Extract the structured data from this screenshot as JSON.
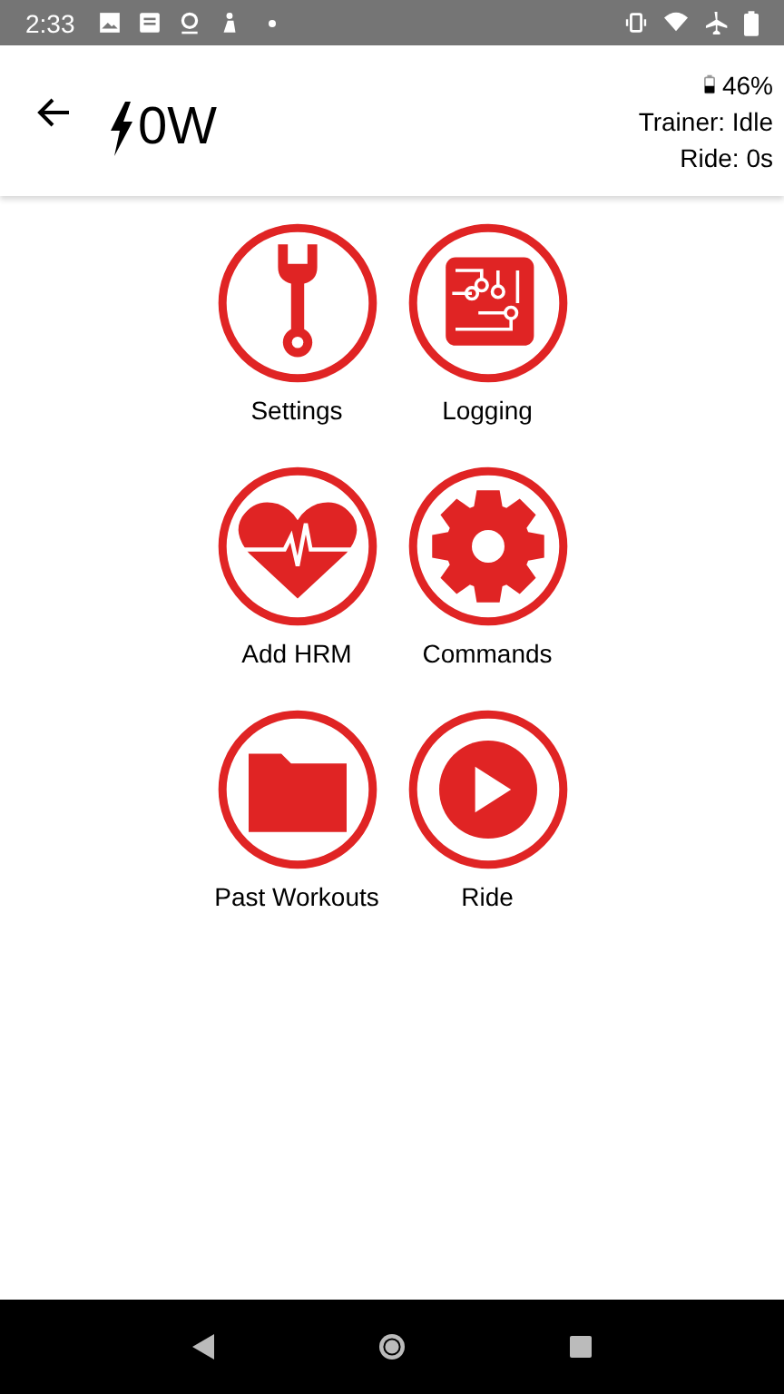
{
  "status_bar": {
    "time": "2:33"
  },
  "header": {
    "power": "0W",
    "battery": "46%",
    "trainer": "Trainer: Idle",
    "ride": "Ride: 0s"
  },
  "tiles": [
    {
      "kind": "wrench",
      "label": "Settings"
    },
    {
      "kind": "circuit",
      "label": "Logging"
    },
    {
      "kind": "heart",
      "label": "Add HRM"
    },
    {
      "kind": "gear",
      "label": "Commands"
    },
    {
      "kind": "folder",
      "label": "Past Workouts"
    },
    {
      "kind": "play",
      "label": "Ride"
    }
  ]
}
